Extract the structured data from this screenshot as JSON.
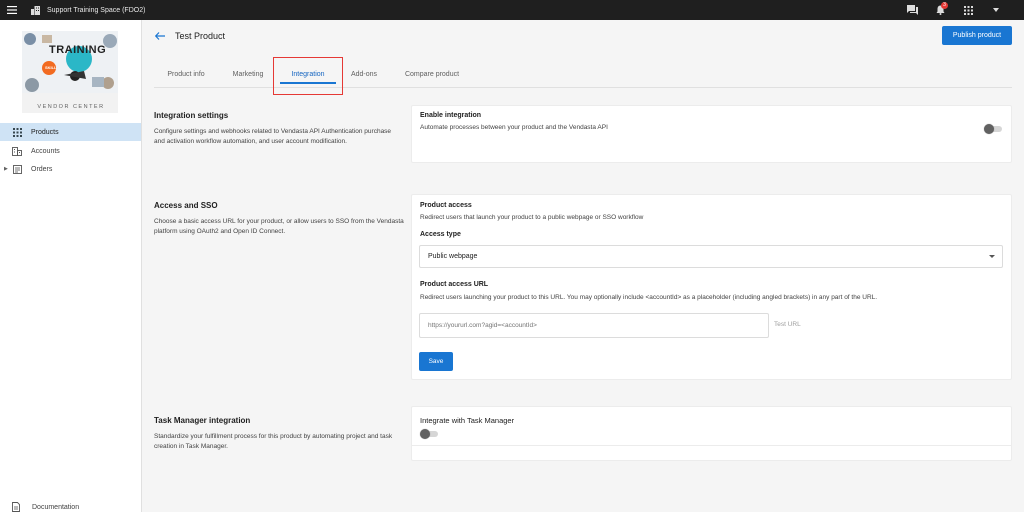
{
  "topbar": {
    "org_name": "Support Training Space (FDO2)",
    "notification_count": "3"
  },
  "sidebar": {
    "logo_text": "TRAINING",
    "logo_subtext": "SKILL",
    "section_label": "VENDOR CENTER",
    "items": [
      {
        "label": "Products",
        "icon": "grid-icon",
        "active": true
      },
      {
        "label": "Accounts",
        "icon": "building-icon",
        "active": false
      },
      {
        "label": "Orders",
        "icon": "orders-icon",
        "active": false
      }
    ],
    "documentation_label": "Documentation"
  },
  "header": {
    "title": "Test Product",
    "publish_label": "Publish product"
  },
  "tabs": [
    {
      "label": "Product info"
    },
    {
      "label": "Marketing"
    },
    {
      "label": "Integration",
      "active": true
    },
    {
      "label": "Add-ons"
    },
    {
      "label": "Compare product"
    }
  ],
  "integration_settings": {
    "title": "Integration settings",
    "description": "Configure settings and webhooks related to Vendasta API Authentication purchase and activation workflow automation, and user account modification.",
    "enable_label": "Enable integration",
    "enable_desc": "Automate processes between your product and the Vendasta API",
    "enabled": false
  },
  "access_sso": {
    "title": "Access and SSO",
    "description": "Choose a basic access URL for your product, or allow users to SSO from the Vendasta platform using OAuth2 and Open ID Connect.",
    "product_access_label": "Product access",
    "product_access_desc": "Redirect users that launch your product to a public webpage or SSO workflow",
    "access_type_label": "Access type",
    "access_type_value": "Public webpage",
    "url_label": "Product access URL",
    "url_desc": "Redirect users launching your product to this URL. You may optionally include <accountId> as a placeholder (including angled brackets) in any part of the URL.",
    "url_placeholder": "https://yoururl.com?agid=<accountId>",
    "url_value": "",
    "test_url_label": "Test URL",
    "save_label": "Save"
  },
  "task_manager": {
    "title": "Task Manager integration",
    "description": "Standardize your fulfillment process for this product by automating project and task creation in Task Manager.",
    "toggle_label": "Integrate with Task Manager",
    "enabled": false
  },
  "colors": {
    "primary": "#1976d2",
    "topbar": "#1f1f1f",
    "active_nav": "#cfe3f5",
    "highlight": "#e53935"
  }
}
